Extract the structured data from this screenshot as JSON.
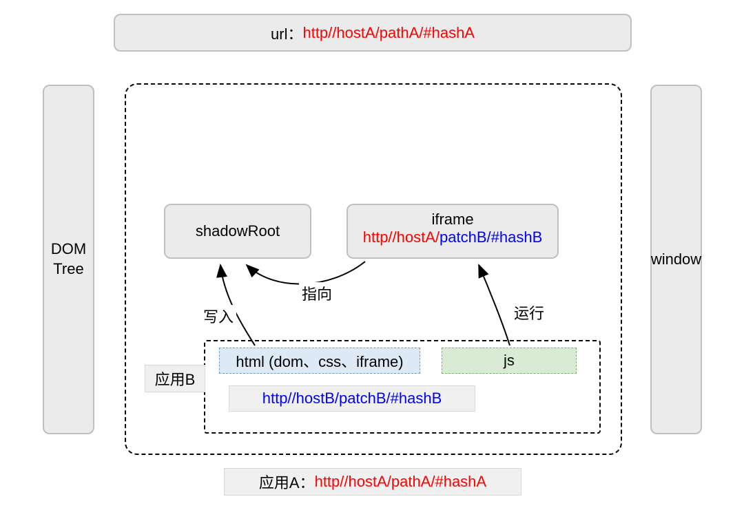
{
  "url_bar": {
    "prefix": "url：",
    "value": "http//hostA/pathA/#hashA"
  },
  "dom_tree": "DOM\nTree",
  "window": "window",
  "shadow_root": "shadowRoot",
  "iframe": {
    "title": "iframe",
    "url_red1": "http//hostA/",
    "url_blue": "patchB/#hashB"
  },
  "app_b": {
    "label": "应用B",
    "html_box": "html (dom、css、iframe)",
    "js_box": "js",
    "url": "http//hostB/patchB/#hashB"
  },
  "app_a": {
    "prefix": "应用A：",
    "url": "http//hostA/pathA/#hashA"
  },
  "arrows": {
    "write": "写入",
    "point": "指向",
    "run": "运行"
  }
}
